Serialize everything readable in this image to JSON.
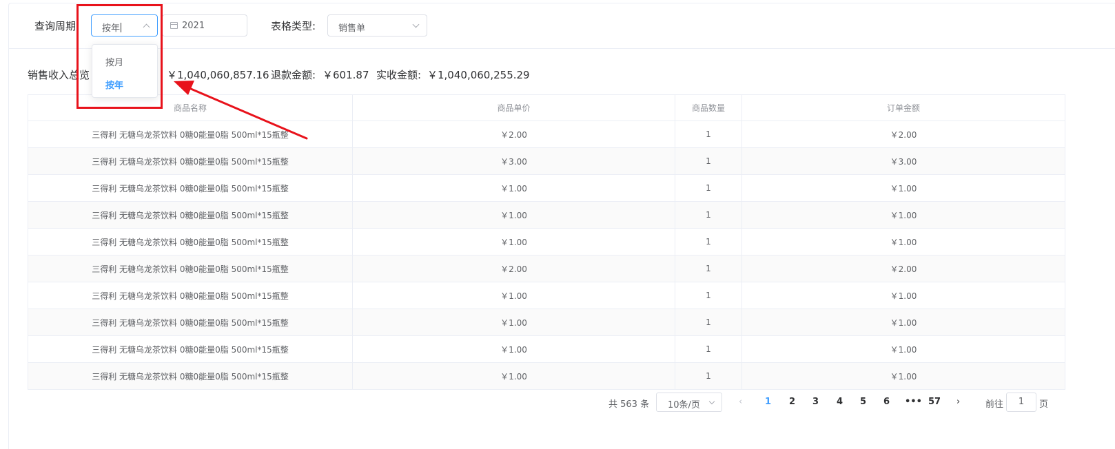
{
  "filter": {
    "period_label": "查询周期:",
    "period_value": "按年",
    "year_value": "2021",
    "type_label": "表格类型:",
    "type_value": "销售单"
  },
  "dropdown": {
    "options": [
      {
        "label": "按月",
        "selected": false
      },
      {
        "label": "按年",
        "selected": true
      }
    ]
  },
  "summary": {
    "title": "销售收入总览",
    "income_value": "￥1,040,060,857.16",
    "refund_label": "退款金额:",
    "refund_value": "￥601.87",
    "actual_label": "实收金额:",
    "actual_value": "￥1,040,060,255.29"
  },
  "table": {
    "headers": [
      "商品名称",
      "商品单价",
      "商品数量",
      "订单金额"
    ],
    "rows": [
      [
        "三得利 无糖乌龙茶饮料 0糖0能量0脂 500ml*15瓶整",
        "￥2.00",
        "1",
        "￥2.00"
      ],
      [
        "三得利 无糖乌龙茶饮料 0糖0能量0脂 500ml*15瓶整",
        "￥3.00",
        "1",
        "￥3.00"
      ],
      [
        "三得利 无糖乌龙茶饮料 0糖0能量0脂 500ml*15瓶整",
        "￥1.00",
        "1",
        "￥1.00"
      ],
      [
        "三得利 无糖乌龙茶饮料 0糖0能量0脂 500ml*15瓶整",
        "￥1.00",
        "1",
        "￥1.00"
      ],
      [
        "三得利 无糖乌龙茶饮料 0糖0能量0脂 500ml*15瓶整",
        "￥1.00",
        "1",
        "￥1.00"
      ],
      [
        "三得利 无糖乌龙茶饮料 0糖0能量0脂 500ml*15瓶整",
        "￥2.00",
        "1",
        "￥2.00"
      ],
      [
        "三得利 无糖乌龙茶饮料 0糖0能量0脂 500ml*15瓶整",
        "￥1.00",
        "1",
        "￥1.00"
      ],
      [
        "三得利 无糖乌龙茶饮料 0糖0能量0脂 500ml*15瓶整",
        "￥1.00",
        "1",
        "￥1.00"
      ],
      [
        "三得利 无糖乌龙茶饮料 0糖0能量0脂 500ml*15瓶整",
        "￥1.00",
        "1",
        "￥1.00"
      ],
      [
        "三得利 无糖乌龙茶饮料 0糖0能量0脂 500ml*15瓶整",
        "￥1.00",
        "1",
        "￥1.00"
      ]
    ]
  },
  "pagination": {
    "total": "共 563 条",
    "page_size": "10条/页",
    "prev": "‹",
    "pages": [
      "1",
      "2",
      "3",
      "4",
      "5",
      "6",
      "•••",
      "57"
    ],
    "current": "1",
    "next": "›",
    "goto_label": "前往",
    "goto_value": "1",
    "goto_suffix": "页"
  },
  "colors": {
    "accent": "#409eff",
    "annotation": "#e8121b",
    "border": "#ebeef5"
  }
}
